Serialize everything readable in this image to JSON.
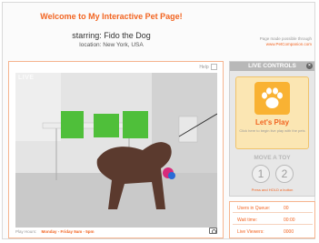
{
  "header": {
    "title": "Welcome to My Interactive Pet Page!",
    "starring": "starring: Fido the Dog",
    "location": "location: New York, USA",
    "credit_line1": "Page made possible through",
    "credit_link": "www.PetCompanion.com"
  },
  "video": {
    "help_label": "Help",
    "watermark": "LIVE",
    "play_hours_label": "Play Hours:",
    "play_hours_value": "Monday - Friday 9am - 5pm"
  },
  "controls": {
    "header": "LIVE CONTROLS",
    "close_glyph": "×",
    "lets_play": "Let's Play",
    "play_sub": "Click here to begin live play with the pets",
    "move_toy": "MOVE A TOY",
    "toy1": "1",
    "toy2": "2",
    "hold_note": "Press and HOLD a button"
  },
  "stats": {
    "rows": [
      {
        "label": "Users in Queue:",
        "value": "00"
      },
      {
        "label": "Wait time:",
        "value": "00:00"
      },
      {
        "label": "Live Viewers:",
        "value": "0000"
      }
    ]
  },
  "colors": {
    "accent": "#f26522",
    "paw_box": "#f9b233"
  },
  "icons": {
    "paw": "paw-icon",
    "camera": "camera-icon",
    "help": "help-icon"
  }
}
